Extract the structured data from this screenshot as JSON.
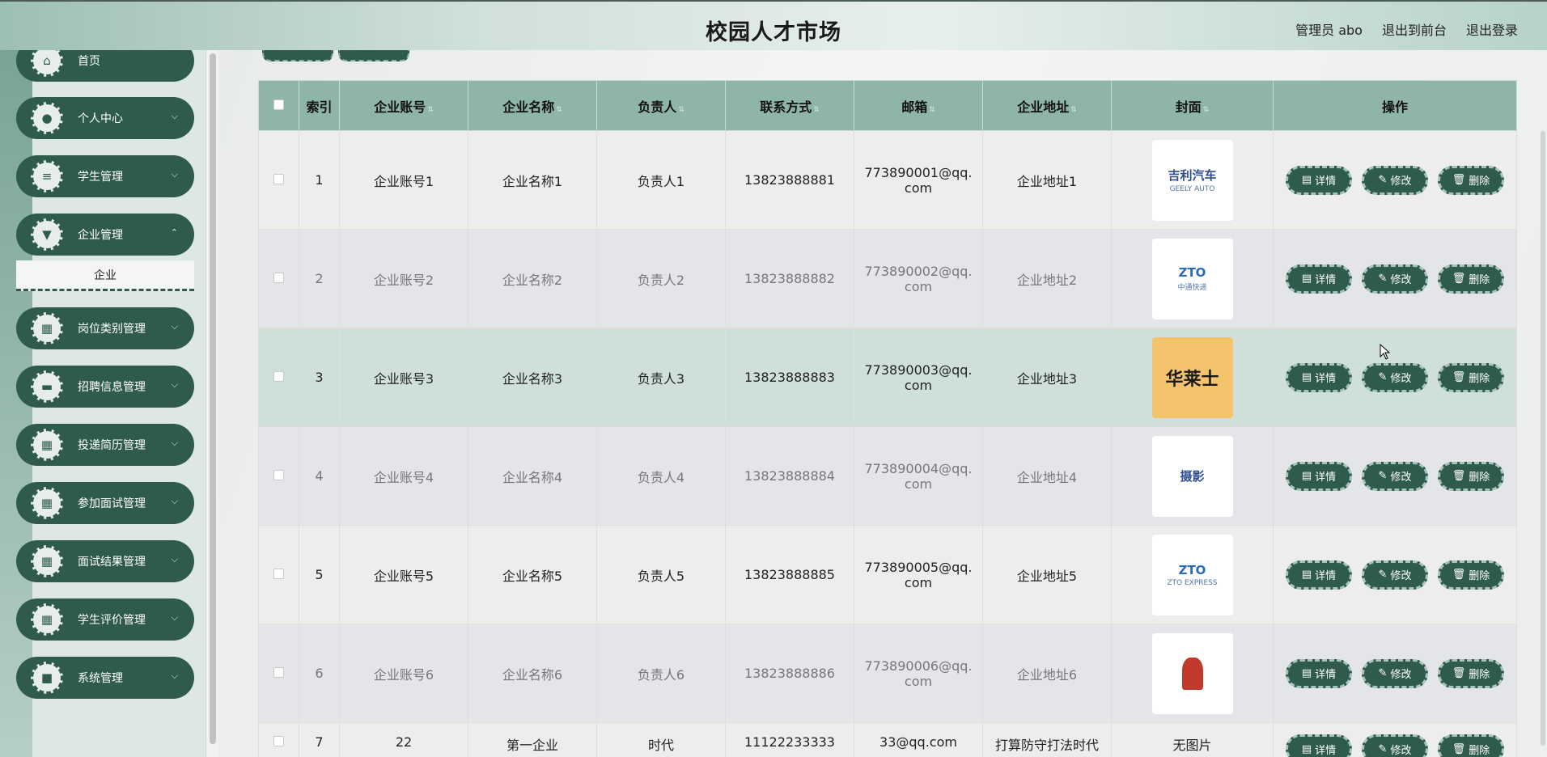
{
  "header": {
    "title": "校园人才市场",
    "user_label": "管理员 abo",
    "front_label": "退出到前台",
    "logout_label": "退出登录"
  },
  "sidebar": {
    "items": [
      {
        "label": "首页",
        "icon": "home-icon"
      },
      {
        "label": "个人中心",
        "icon": "user-icon"
      },
      {
        "label": "学生管理",
        "icon": "list-icon"
      },
      {
        "label": "企业管理",
        "icon": "pin-icon"
      },
      {
        "label": "岗位类别管理",
        "icon": "grid-icon"
      },
      {
        "label": "招聘信息管理",
        "icon": "chat-icon"
      },
      {
        "label": "投递简历管理",
        "icon": "grid-icon"
      },
      {
        "label": "参加面试管理",
        "icon": "grid-icon"
      },
      {
        "label": "面试结果管理",
        "icon": "grid-icon"
      },
      {
        "label": "学生评价管理",
        "icon": "grid-icon"
      },
      {
        "label": "系统管理",
        "icon": "video-icon"
      }
    ],
    "submenu_label": "企业"
  },
  "table": {
    "headers": {
      "index": "索引",
      "account": "企业账号",
      "name": "企业名称",
      "manager": "负责人",
      "phone": "联系方式",
      "email": "邮箱",
      "address": "企业地址",
      "cover": "封面",
      "ops": "操作"
    },
    "rows": [
      {
        "index": "1",
        "account": "企业账号1",
        "name": "企业名称1",
        "manager": "负责人1",
        "phone": "13823888881",
        "email": "773890001@qq.com",
        "address": "企业地址1",
        "cover_text": "吉利汽车",
        "cover_sub": "GEELY AUTO"
      },
      {
        "index": "2",
        "account": "企业账号2",
        "name": "企业名称2",
        "manager": "负责人2",
        "phone": "13823888882",
        "email": "773890002@qq.com",
        "address": "企业地址2",
        "cover_text": "ZTO",
        "cover_sub": "中通快递"
      },
      {
        "index": "3",
        "account": "企业账号3",
        "name": "企业名称3",
        "manager": "负责人3",
        "phone": "13823888883",
        "email": "773890003@qq.com",
        "address": "企业地址3",
        "cover_text": "华莱士",
        "cover_sub": ""
      },
      {
        "index": "4",
        "account": "企业账号4",
        "name": "企业名称4",
        "manager": "负责人4",
        "phone": "13823888884",
        "email": "773890004@qq.com",
        "address": "企业地址4",
        "cover_text": "摄影",
        "cover_sub": ""
      },
      {
        "index": "5",
        "account": "企业账号5",
        "name": "企业名称5",
        "manager": "负责人5",
        "phone": "13823888885",
        "email": "773890005@qq.com",
        "address": "企业地址5",
        "cover_text": "ZTO",
        "cover_sub": "ZTO EXPRESS"
      },
      {
        "index": "6",
        "account": "企业账号6",
        "name": "企业名称6",
        "manager": "负责人6",
        "phone": "13823888886",
        "email": "773890006@qq.com",
        "address": "企业地址6",
        "cover_text": "",
        "cover_sub": ""
      },
      {
        "index": "7",
        "account": "22",
        "name": "第一企业",
        "manager": "时代",
        "phone": "11122233333",
        "email": "33@qq.com",
        "address": "打算防守打法时代四方都",
        "cover_text": "无图片",
        "cover_sub": ""
      }
    ],
    "ops": {
      "detail": "详情",
      "edit": "修改",
      "delete": "删除"
    }
  },
  "colors": {
    "primary": "#2f5b4d",
    "header_bg": "#8fb5a7",
    "hover_row": "#cfe0d8"
  }
}
